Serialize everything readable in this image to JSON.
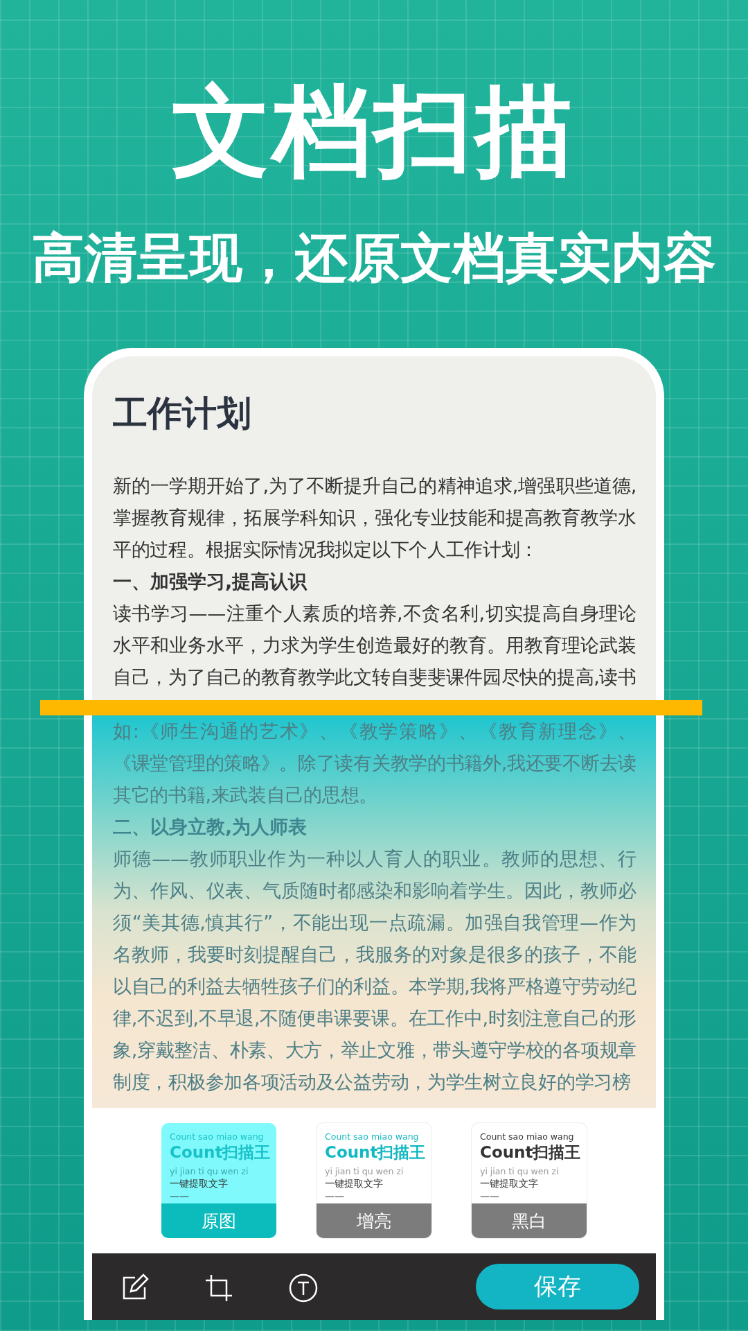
{
  "hero": {
    "title": "文档扫描",
    "subtitle": "高清呈现，还原文档真实内容"
  },
  "document": {
    "title": "工作计划",
    "blocks": [
      {
        "kind": "paragraph",
        "text": "新的一学期开始了,为了不断提升自己的精神追求,增强职些道德,掌握教育规律，拓展学科知识，强化专业技能和提高教育教学水平的过程。根据实际情况我拟定以下个人工作计划："
      },
      {
        "kind": "heading",
        "text": "一、加强学习,提高认识"
      },
      {
        "kind": "paragraph",
        "text": "读书学习——注重个人素质的培养,不贪名利,切实提高自身理论水平和业务水平，力求为学生创造最好的教育。用教育理论武装自己，为了自己的教育教学此文转自斐斐课件园尽快的提高,读书"
      }
    ]
  },
  "scan_area": {
    "blocks": [
      {
        "kind": "paragraph",
        "text": "如:《师生沟通的艺术》、《教学策略》、《教育新理念》、《课堂管理的策略》。除了读有关教学的书籍外,我还要不断去读其它的书籍,来武装自己的思想。"
      },
      {
        "kind": "heading",
        "text": "二、以身立教,为人师表"
      },
      {
        "kind": "paragraph",
        "text": "师德——教师职业作为一种以人育人的职业。教师的思想、行为、作风、仪表、气质随时都感染和影响着学生。因此，教师必须“美其德,慎其行”，不能出现一点疏漏。加强自我管理—作为名教师，我要时刻提醒自己，我服务的对象是很多的孩子，不能以自己的利益去牺牲孩子们的利益。本学期,我将严格遵守劳动纪律,不迟到,不早退,不随便串课要课。在工作中,时刻注意自己的形象,穿戴整洁、朴素、大方，举止文雅，带头遵守学校的各项规章制度，积极参加各项活动及公益劳动，为学生树立良好的学习榜"
      }
    ]
  },
  "filters": [
    {
      "kind": "original",
      "label": "原图",
      "selected": true,
      "lines": [
        "Count sao miao wang",
        "Count扫描王",
        "yi jian ti qu wen zi",
        "一键提取文字",
        "——"
      ]
    },
    {
      "kind": "enhanced",
      "label": "增亮",
      "selected": false,
      "lines": [
        "Count sao miao wang",
        "Count扫描王",
        "yi jian ti qu wen zi",
        "一键提取文字",
        "——"
      ]
    },
    {
      "kind": "mono",
      "label": "黑白",
      "selected": false,
      "lines": [
        "Count sao miao wang",
        "Count扫描王",
        "yi jian ti qu wen zi",
        "一键提取文字",
        "——"
      ]
    }
  ],
  "toolbar": {
    "tools": [
      {
        "kind": "edit"
      },
      {
        "kind": "crop"
      },
      {
        "kind": "text"
      }
    ],
    "save_button": "保存"
  }
}
